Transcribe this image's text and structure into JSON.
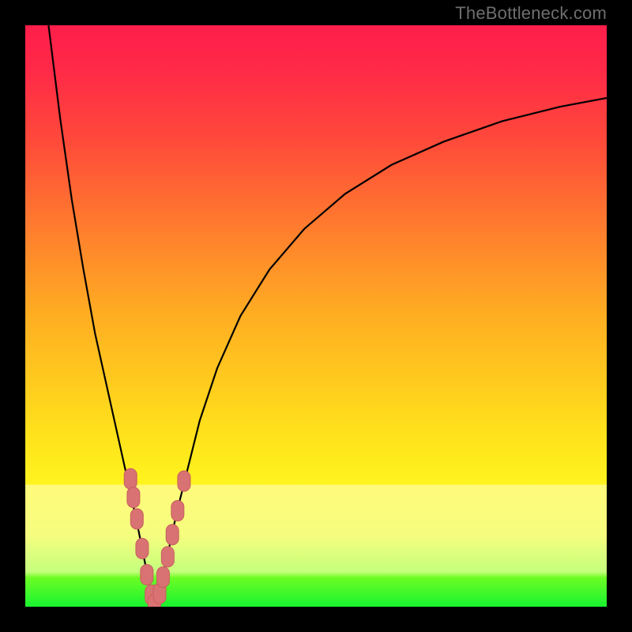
{
  "watermark": "TheBottleneck.com",
  "colors": {
    "frame": "#000000",
    "curve": "#000000",
    "marker_fill": "#d97272",
    "marker_stroke": "#c75f5f",
    "gradient_top": "#ff1e4b",
    "gradient_mid": "#ffe11b",
    "gradient_bottom": "#18f330"
  },
  "chart_data": {
    "type": "line",
    "title": "",
    "xlabel": "",
    "ylabel": "",
    "xlim": [
      0,
      100
    ],
    "ylim": [
      0,
      100
    ],
    "series": [
      {
        "name": "left-branch",
        "x": [
          4,
          5,
          6,
          8,
          10,
          12,
          14,
          16,
          18,
          19.5,
          20.5,
          21.5,
          22.2
        ],
        "y": [
          100,
          92,
          84,
          70,
          58,
          47,
          38,
          29,
          20,
          13,
          8,
          3,
          0
        ]
      },
      {
        "name": "right-branch",
        "x": [
          22.2,
          23.2,
          24.5,
          26,
          28,
          30,
          33,
          37,
          42,
          48,
          55,
          63,
          72,
          82,
          92,
          100
        ],
        "y": [
          0,
          3,
          9,
          16,
          24,
          32,
          41,
          50,
          58,
          65,
          71,
          76,
          80,
          83.5,
          86,
          87.5
        ]
      }
    ],
    "markers": {
      "name": "highlight-points",
      "points": [
        {
          "x": 18.1,
          "y": 22.0
        },
        {
          "x": 18.6,
          "y": 18.8
        },
        {
          "x": 19.2,
          "y": 15.1
        },
        {
          "x": 20.1,
          "y": 10.0
        },
        {
          "x": 20.9,
          "y": 5.5
        },
        {
          "x": 21.7,
          "y": 2.0
        },
        {
          "x": 22.2,
          "y": 0.4
        },
        {
          "x": 23.1,
          "y": 2.3
        },
        {
          "x": 23.7,
          "y": 5.1
        },
        {
          "x": 24.5,
          "y": 8.6
        },
        {
          "x": 25.3,
          "y": 12.4
        },
        {
          "x": 26.2,
          "y": 16.5
        },
        {
          "x": 27.3,
          "y": 21.6
        }
      ]
    }
  }
}
